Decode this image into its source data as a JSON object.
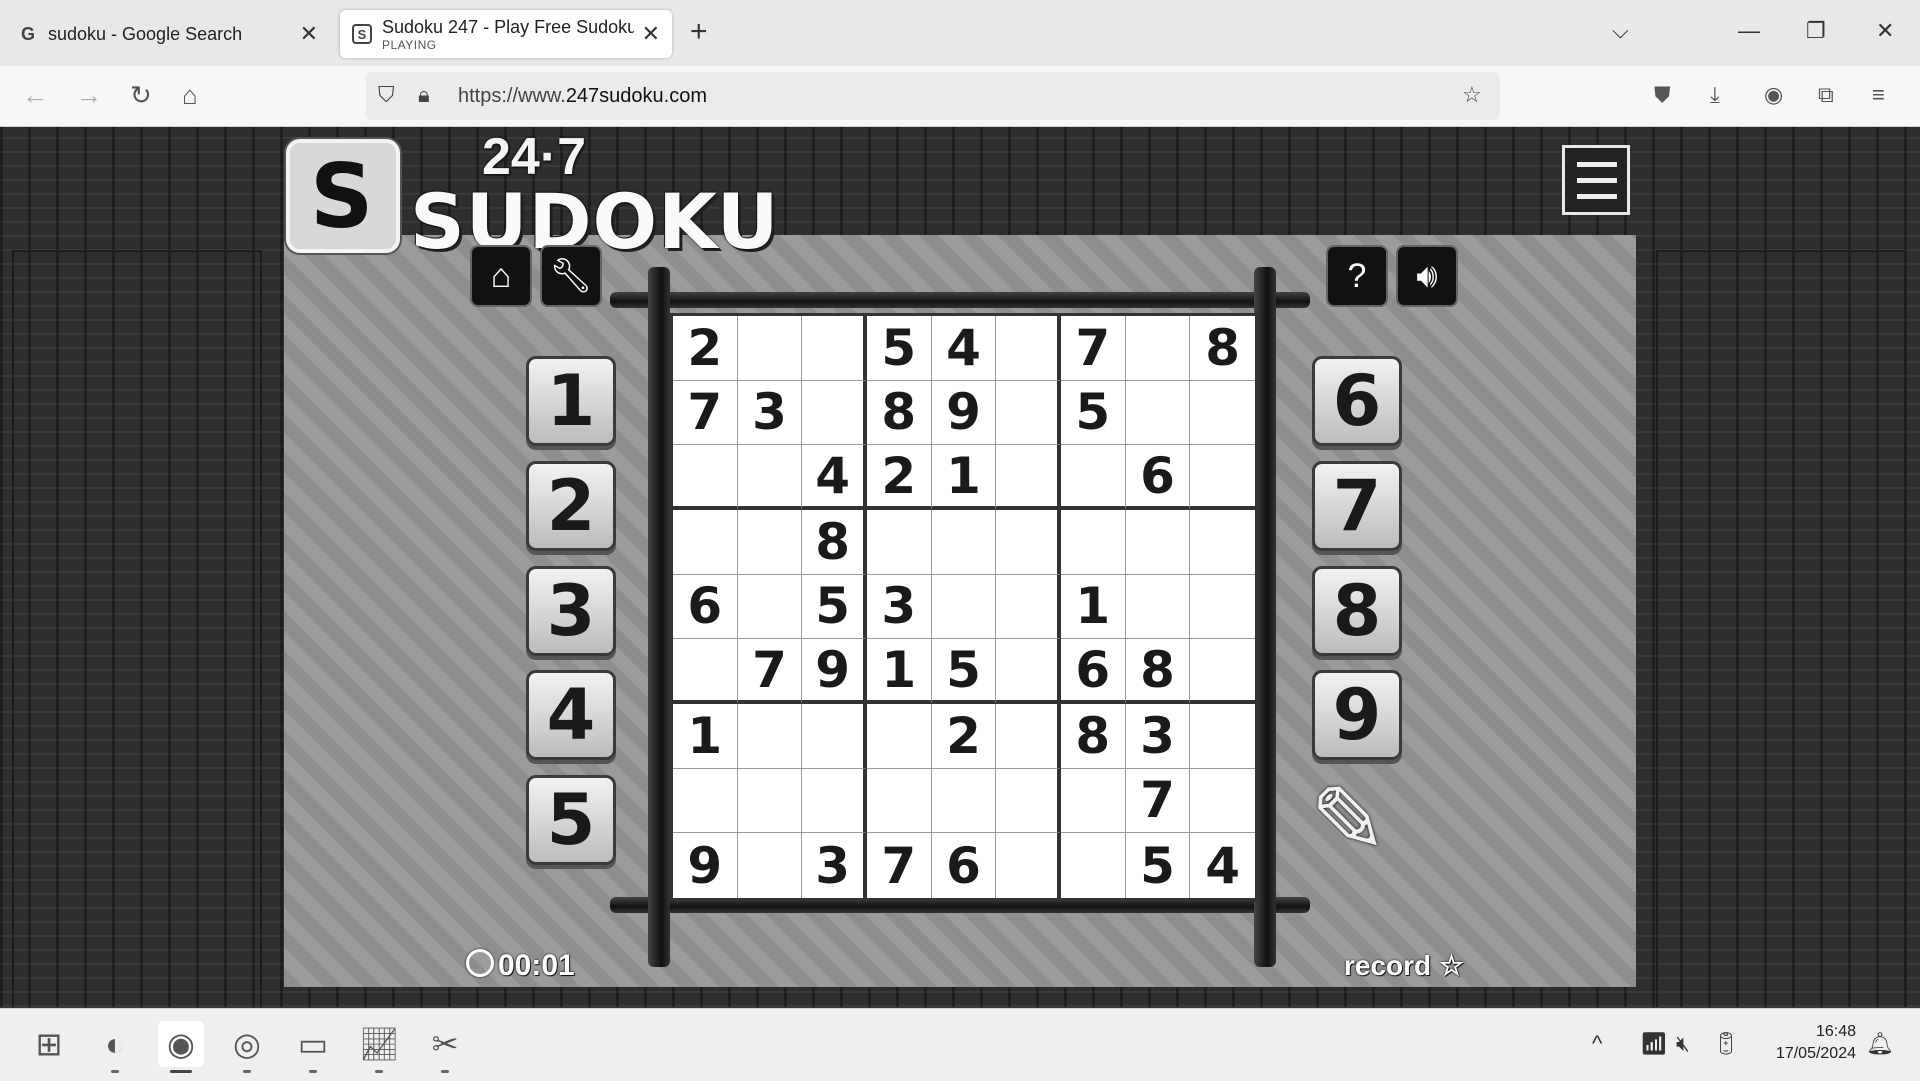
{
  "browser": {
    "tabs": [
      {
        "favicon": "G",
        "title": "sudoku - Google Search",
        "subtitle": ""
      },
      {
        "favicon": "S",
        "title": "Sudoku 247 - Play Free Sudoku",
        "subtitle": "PLAYING"
      }
    ],
    "url_prefix": "https://www.",
    "url_domain": "247sudoku.com"
  },
  "game": {
    "logo_number": "24·7",
    "logo_title": "SUDOKU",
    "logo_letter": "S",
    "left_numbers": [
      "1",
      "2",
      "3",
      "4",
      "5"
    ],
    "right_numbers": [
      "6",
      "7",
      "8",
      "9"
    ],
    "timer": "00:01",
    "record_label": "record",
    "record_star": "☆",
    "grid": [
      [
        "2",
        "",
        "",
        "5",
        "4",
        "",
        "7",
        "",
        "8"
      ],
      [
        "7",
        "3",
        "",
        "8",
        "9",
        "",
        "5",
        "",
        ""
      ],
      [
        "",
        "",
        "4",
        "2",
        "1",
        "",
        "",
        "6",
        ""
      ],
      [
        "",
        "",
        "8",
        "",
        "",
        "",
        "",
        "",
        ""
      ],
      [
        "6",
        "",
        "5",
        "3",
        "",
        "",
        "1",
        "",
        ""
      ],
      [
        "",
        "7",
        "9",
        "1",
        "5",
        "",
        "6",
        "8",
        ""
      ],
      [
        "1",
        "",
        "",
        "",
        "2",
        "",
        "8",
        "3",
        ""
      ],
      [
        "",
        "",
        "",
        "",
        "",
        "",
        "",
        "7",
        ""
      ],
      [
        "9",
        "",
        "3",
        "7",
        "6",
        "",
        "",
        "5",
        "4"
      ]
    ]
  },
  "taskbar": {
    "time": "16:48",
    "date": "17/05/2024"
  }
}
